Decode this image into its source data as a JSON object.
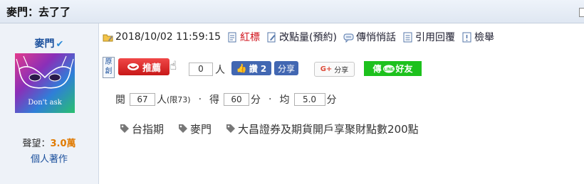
{
  "header": {
    "title": "麥門：去了了"
  },
  "sidebar": {
    "author_name": "麥門",
    "verified_icon": "check-icon",
    "avatar_caption": "Don't ask",
    "fame_label": "聲望：",
    "fame_value": "3.0萬",
    "works_link": "個人著作"
  },
  "toolbar": {
    "timestamp": "2018/10/02 11:59:15",
    "red_tag_label": "紅標",
    "edit_points_label": "改點量(預約)",
    "whisper_label": "傳悄悄話",
    "quote_reply_label": "引用回覆",
    "report_label": "檢舉"
  },
  "social": {
    "original_label": "原創",
    "recommend_label": "推薦",
    "recommend_count": "0",
    "people_unit": "人",
    "fb_like_label": "讚 2",
    "fb_share_label": "分享",
    "gplus_label": "分享",
    "line_label": "傳",
    "line_suffix": "好友"
  },
  "stats": {
    "views_label": "閱",
    "views_value": "67",
    "views_unit": "人",
    "views_limit": "(限73)",
    "gain_label": "得",
    "gain_value": "60",
    "gain_unit": "分",
    "avg_label": "均",
    "avg_value": "5.0",
    "avg_unit": "分"
  },
  "tags": [
    "台指期",
    "麥門",
    "大昌證券及期貨開戶享聚財點數200點"
  ],
  "colors": {
    "accent_blue": "#1a4f9c",
    "red": "#d0121b",
    "fb_blue": "#4267b2",
    "line_green": "#1dc11d",
    "fame_orange": "#e07a00"
  }
}
